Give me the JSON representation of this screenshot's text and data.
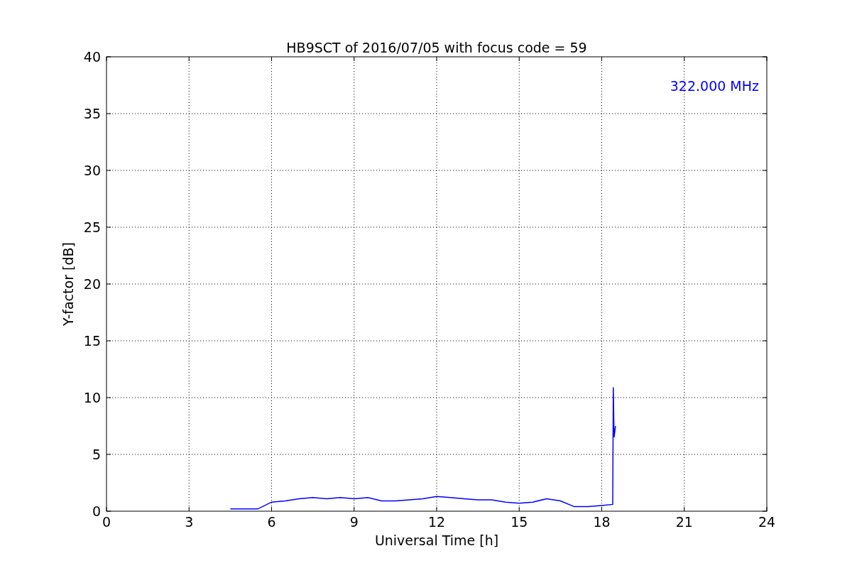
{
  "chart_data": {
    "type": "line",
    "title": "HB9SCT of 2016/07/05 with focus code = 59",
    "xlabel": "Universal Time [h]",
    "ylabel": "Y-factor [dB]",
    "xlim": [
      0,
      24
    ],
    "ylim": [
      0,
      40
    ],
    "grid": true,
    "xticks": [
      0,
      3,
      6,
      9,
      12,
      15,
      18,
      21,
      24
    ],
    "yticks": [
      0,
      5,
      10,
      15,
      20,
      25,
      30,
      35,
      40
    ],
    "x": [
      4.5,
      5,
      5.5,
      6,
      6.5,
      7,
      7.5,
      8,
      8.5,
      9,
      9.5,
      10,
      10.5,
      11,
      11.5,
      12,
      12.5,
      13,
      13.5,
      14,
      14.5,
      15,
      15.5,
      16,
      16.5,
      17,
      17.5,
      18,
      18.4,
      18.42,
      18.45,
      18.5
    ],
    "series": [
      {
        "name": "322.000 MHz",
        "color": "#0000ff",
        "values": [
          0.2,
          0.2,
          0.2,
          0.8,
          0.9,
          1.1,
          1.2,
          1.1,
          1.2,
          1.1,
          1.2,
          0.9,
          0.9,
          1.0,
          1.1,
          1.3,
          1.2,
          1.1,
          1.0,
          1.0,
          0.8,
          0.7,
          0.8,
          1.1,
          0.9,
          0.4,
          0.4,
          0.5,
          0.6,
          10.9,
          6.5,
          7.5
        ]
      }
    ]
  }
}
